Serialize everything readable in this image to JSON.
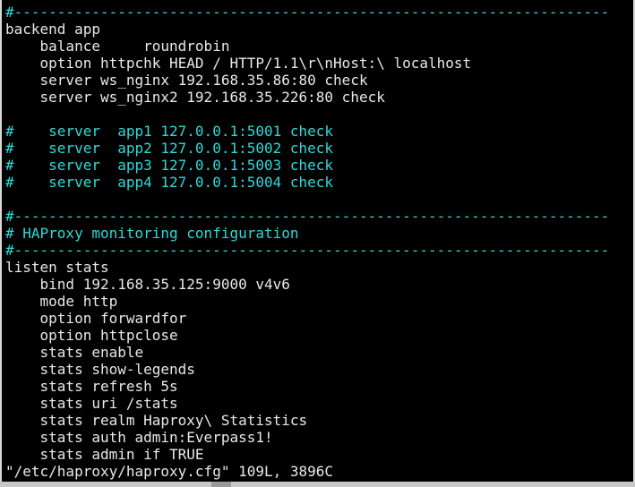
{
  "window": {
    "title": ""
  },
  "lines": [
    {
      "text": "#---------------------------------------------------------------------",
      "style": "comment"
    },
    {
      "text": "backend app",
      "style": "normal"
    },
    {
      "text": "    balance     roundrobin",
      "style": "normal"
    },
    {
      "text": "    option httpchk HEAD / HTTP/1.1\\r\\nHost:\\ localhost",
      "style": "normal"
    },
    {
      "text": "    server ws_nginx 192.168.35.86:80 check",
      "style": "normal"
    },
    {
      "text": "    server ws_nginx2 192.168.35.226:80 check",
      "style": "normal"
    },
    {
      "text": "",
      "style": "normal"
    },
    {
      "text": "#    server  app1 127.0.0.1:5001 check",
      "style": "comment"
    },
    {
      "text": "#    server  app2 127.0.0.1:5002 check",
      "style": "comment"
    },
    {
      "text": "#    server  app3 127.0.0.1:5003 check",
      "style": "comment"
    },
    {
      "text": "#    server  app4 127.0.0.1:5004 check",
      "style": "comment"
    },
    {
      "text": "",
      "style": "normal"
    },
    {
      "text": "#---------------------------------------------------------------------",
      "style": "comment"
    },
    {
      "text": "# HAProxy monitoring configuration",
      "style": "comment"
    },
    {
      "text": "#---------------------------------------------------------------------",
      "style": "comment"
    },
    {
      "text": "listen stats",
      "style": "normal"
    },
    {
      "text": "    bind 192.168.35.125:9000 v4v6",
      "style": "normal"
    },
    {
      "text": "    mode http",
      "style": "normal"
    },
    {
      "text": "    option forwardfor",
      "style": "normal"
    },
    {
      "text": "    option httpclose",
      "style": "normal"
    },
    {
      "text": "    stats enable",
      "style": "normal"
    },
    {
      "text": "    stats show-legends",
      "style": "normal"
    },
    {
      "text": "    stats refresh 5s",
      "style": "normal"
    },
    {
      "text": "    stats uri /stats",
      "style": "normal"
    },
    {
      "text": "    stats realm Haproxy\\ Statistics",
      "style": "normal"
    },
    {
      "text": "    stats auth admin:Everpass1!",
      "style": "normal"
    },
    {
      "text": "    stats admin if TRUE",
      "style": "normal"
    }
  ],
  "status_line": "\"/etc/haproxy/haproxy.cfg\" 109L, 3896C",
  "colors": {
    "background": "#000000",
    "text": "#e8e8e8",
    "comment": "#2fd8d8"
  }
}
